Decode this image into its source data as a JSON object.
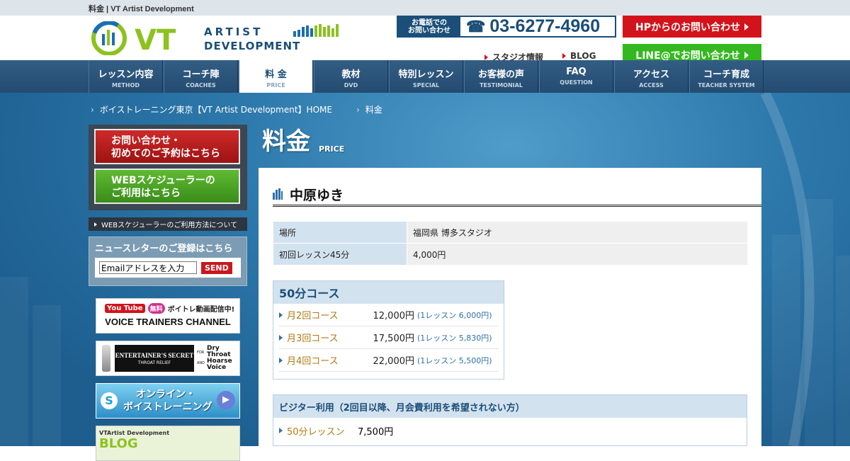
{
  "top": {
    "breadcrumb_text": "料金 | VT Artist Development"
  },
  "logo": {
    "vt": "VT",
    "artist": "ARTIST",
    "development": "DEVELOPMENT"
  },
  "phone": {
    "label_line1": "お電話での",
    "label_line2": "お問い合わせ",
    "number": "03-6277-4960"
  },
  "header_buttons": {
    "hp_contact": "HPからのお問い合わせ",
    "line_contact": "LINE@でお問い合わせ"
  },
  "header_links": {
    "studio": "スタジオ情報",
    "blog": "BLOG"
  },
  "nav": [
    {
      "jp": "レッスン内容",
      "en": "METHOD"
    },
    {
      "jp": "コーチ陣",
      "en": "COACHES"
    },
    {
      "jp": "料 金",
      "en": "PRICE"
    },
    {
      "jp": "教材",
      "en": "DVD"
    },
    {
      "jp": "特別レッスン",
      "en": "SPECIAL"
    },
    {
      "jp": "お客様の声",
      "en": "TESTIMONIAL"
    },
    {
      "jp": "FAQ",
      "en": "QUESTION"
    },
    {
      "jp": "アクセス",
      "en": "ACCESS"
    },
    {
      "jp": "コーチ育成",
      "en": "TEACHER SYSTEM"
    }
  ],
  "breadcrumb": {
    "home": "ボイストレーニング東京【VT Artist Development】HOME",
    "current": "料金"
  },
  "sidebar": {
    "cta_contact_line1": "お問い合わせ・",
    "cta_contact_line2": "初めてのご予約はこちら",
    "cta_sched_line1": "WEBスケジューラーの",
    "cta_sched_line2": "ご利用はこちら",
    "sched_howto": "WEBスケジューラーのご利用方法について",
    "newsletter_title": "ニュースレターのご登録はこちら",
    "email_placeholder": "Emailアドレスを入力",
    "send": "SEND",
    "banner_youtube_logo": "You Tube",
    "banner_youtube_free": "無料",
    "banner_youtube_text": "ボイトレ動画配信中!",
    "banner_youtube_channel": "VOICE TRAINERS CHANNEL",
    "banner_es_title": "ENTERTAINER'S SECRET",
    "banner_es_sub": "THROAT RELIEF",
    "banner_es_for": "FOR",
    "banner_es_dry": "Dry",
    "banner_es_throat": "Throat",
    "banner_es_and": "AND",
    "banner_es_hoarse": "Hoarse",
    "banner_es_voice": "Voice",
    "banner_online_line1": "オンライン・",
    "banner_online_line2": "ボイストレーニング",
    "banner_blog_label": "VTArtist Development",
    "banner_blog_text": "BLOG"
  },
  "content": {
    "title_jp": "料金",
    "title_en": "PRICE",
    "coach_name": "中原ゆき",
    "info": [
      {
        "key": "場所",
        "value": "福岡県 博多スタジオ"
      },
      {
        "key": "初回レッスン45分",
        "value": "4,000円"
      }
    ],
    "course_title": "50分コース",
    "courses": [
      {
        "name": "月2回コース",
        "price": "12,000円",
        "unit": "(1レッスン 6,000円)"
      },
      {
        "name": "月3回コース",
        "price": "17,500円",
        "unit": "(1レッスン 5,830円)"
      },
      {
        "name": "月4回コース",
        "price": "22,000円",
        "unit": "(1レッスン 5,500円)"
      }
    ],
    "visitor_title": "ビジター利用（2回目以降、月会費利用を希望されない方）",
    "visitor_item": {
      "name": "50分レッスン",
      "price": "7,500円"
    }
  },
  "colors": {
    "brand_blue": "#1b4e78",
    "accent_red": "#d3131b",
    "accent_green": "#34b81f",
    "logo_green": "#8dc21f"
  }
}
